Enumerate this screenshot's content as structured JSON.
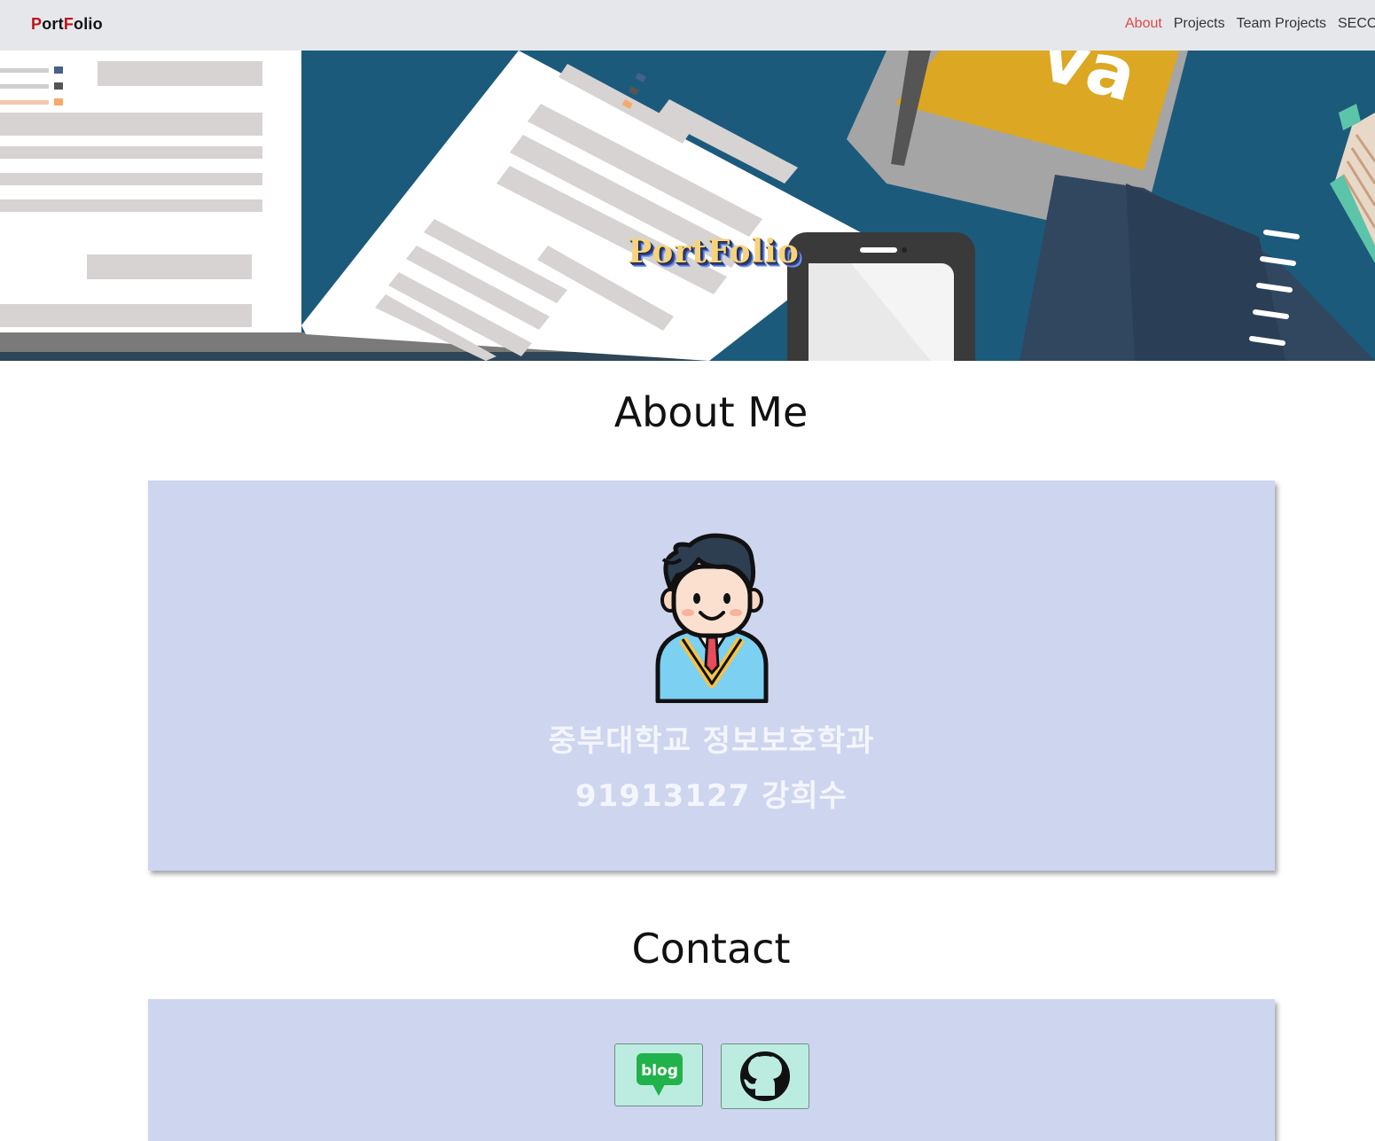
{
  "navbar": {
    "brand_first": "P",
    "brand_mid": "ort",
    "brand_f": "F",
    "brand_end": "olio",
    "links": [
      {
        "label": "About",
        "active": true
      },
      {
        "label": "Projects",
        "active": false
      },
      {
        "label": "Team Projects",
        "active": false
      },
      {
        "label": "SECO",
        "active": false
      }
    ]
  },
  "hero": {
    "title": "PortFolio",
    "background_text": "va"
  },
  "about": {
    "heading": "About Me",
    "school": "중부대학교 정보보호학과",
    "student": "91913127 강희수",
    "avatar_icon": "student-avatar-icon"
  },
  "contact": {
    "heading": "Contact",
    "buttons": [
      {
        "name": "blog",
        "icon": "blog-icon",
        "label": "blog"
      },
      {
        "name": "github",
        "icon": "github-icon"
      }
    ]
  },
  "colors": {
    "navbar_bg": "#e5e7eb",
    "active_link": "#e04848",
    "card_bg": "#ced5ef",
    "contact_btn_bg": "#bcece0"
  }
}
